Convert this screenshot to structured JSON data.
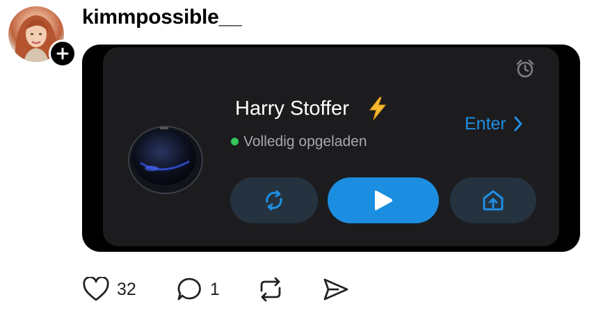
{
  "post": {
    "username": "kimmpossible__",
    "avatar_icon": "profile-photo",
    "follow_icon": "plus-icon"
  },
  "card": {
    "device_name": "Harry Stoffer",
    "device_emoji": "⚡",
    "status": "Volledig opgeladen",
    "status_color": "#34c759",
    "enter_label": "Enter",
    "accent": "#1c8ee1",
    "controls": [
      {
        "name": "cycle-mode",
        "icon": "refresh-arrows-icon"
      },
      {
        "name": "start",
        "icon": "play-icon"
      },
      {
        "name": "return-home",
        "icon": "home-upload-icon"
      }
    ]
  },
  "actions": {
    "likes": "32",
    "comments": "1",
    "icons": [
      "heart-icon",
      "comment-icon",
      "repost-icon",
      "share-icon"
    ]
  }
}
